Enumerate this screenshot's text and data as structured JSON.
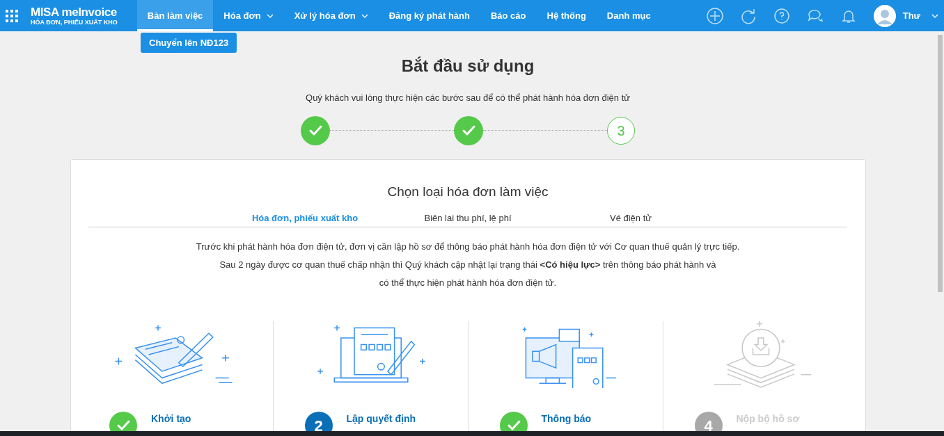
{
  "header": {
    "brand": "MISA meInvoice",
    "subtitle": "HÓA ĐƠN, PHIẾU XUẤT KHO",
    "user": "Thư"
  },
  "nav": [
    {
      "label": "Bàn làm việc",
      "selected": true,
      "dropdown": false
    },
    {
      "label": "Hóa đơn",
      "selected": false,
      "dropdown": true
    },
    {
      "label": "Xử lý hóa đơn",
      "selected": false,
      "dropdown": true
    },
    {
      "label": "Đăng ký phát hành",
      "selected": false,
      "dropdown": false
    },
    {
      "label": "Báo cáo",
      "selected": false,
      "dropdown": false
    },
    {
      "label": "Hệ thống",
      "selected": false,
      "dropdown": false
    },
    {
      "label": "Danh mục",
      "selected": false,
      "dropdown": false
    }
  ],
  "submenu_button": "Chuyển lên NĐ123",
  "title": "Bắt đầu sử dụng",
  "subtitle": "Quý khách vui lòng thực hiện các bước sau để có thể phát hành hóa đơn điện tử",
  "progress": [
    {
      "kind": "done"
    },
    {
      "kind": "done"
    },
    {
      "kind": "current",
      "label": "3"
    }
  ],
  "card": {
    "title": "Chọn loại hóa đơn làm việc",
    "tabs": [
      {
        "label": "Hóa đơn, phiếu xuất kho",
        "selected": true
      },
      {
        "label": "Biên lai thu phí, lệ phí",
        "selected": false
      },
      {
        "label": "Vé điện tử",
        "selected": false
      }
    ],
    "paragraphs": [
      "Trước khi phát hành hóa đơn điện tử, đơn vị cần lập hồ sơ để thông báo phát hành hóa đơn điện tử với Cơ quan thuế quản lý trực tiếp.",
      "Sau 2 ngày được cơ quan thuế chấp nhận thì Quý khách cập nhật lại trạng thái **<Có hiệu lực>** trên thông báo phát hành và",
      "có thể thực hiện phát hành hóa đơn điện tử."
    ],
    "steps": [
      {
        "label": "Khởi tạo",
        "kind": "done"
      },
      {
        "label": "Lập quyết định",
        "kind": "current",
        "number": "2"
      },
      {
        "label": "Thông báo",
        "kind": "done"
      },
      {
        "label": "Nộp bộ hồ sơ",
        "kind": "pending",
        "number": "4"
      }
    ]
  }
}
